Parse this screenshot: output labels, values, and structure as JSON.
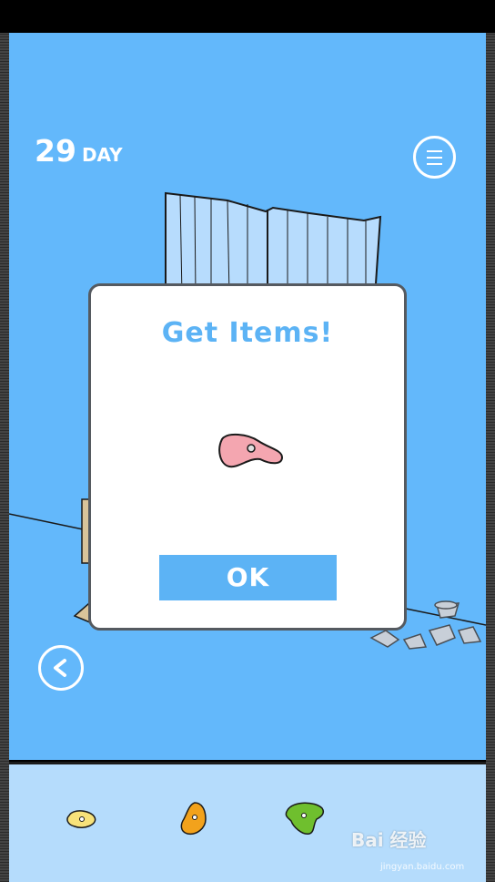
{
  "hud": {
    "day_number": "29",
    "day_unit": "DAY",
    "menu_icon": "hamburger-icon",
    "back_icon": "chevron-left-icon"
  },
  "dialog": {
    "title": "Get Items!",
    "ok_label": "OK",
    "item_icon": "pink-climbing-hold-icon"
  },
  "inventory": {
    "items": [
      {
        "icon": "yellow-climbing-hold-icon",
        "color": "#f7e27a"
      },
      {
        "icon": "orange-climbing-hold-icon",
        "color": "#f2a21c"
      },
      {
        "icon": "green-climbing-hold-icon",
        "color": "#6fbf2e"
      }
    ]
  },
  "colors": {
    "sky": "#63b8fb",
    "accent": "#5cb3f5",
    "inventory_bg": "#b5dcfc",
    "item_pink": "#f4a6b0"
  },
  "watermark": {
    "text": "Bai 经验",
    "sub": "jingyan.baidu.com"
  }
}
